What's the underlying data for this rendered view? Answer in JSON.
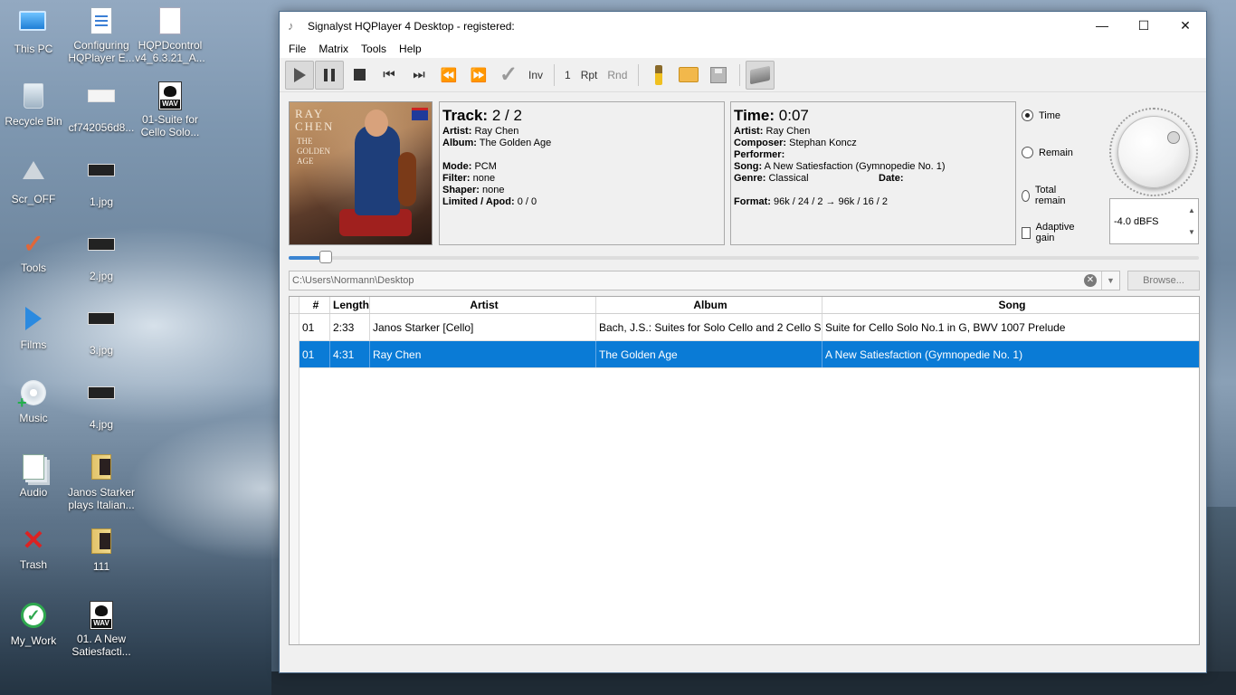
{
  "desktop": {
    "icons": [
      {
        "label": "This PC"
      },
      {
        "label": "Configuring HQPlayer E..."
      },
      {
        "label": "HQPDcontrol v4_6.3.21_A..."
      },
      {
        "label": "Recycle Bin"
      },
      {
        "label": "cf742056d8..."
      },
      {
        "label": "01-Suite for Cello Solo..."
      },
      {
        "label": "Scr_OFF"
      },
      {
        "label": "1.jpg"
      },
      {
        "label": "Tools"
      },
      {
        "label": "2.jpg"
      },
      {
        "label": "Films"
      },
      {
        "label": "3.jpg"
      },
      {
        "label": "Music"
      },
      {
        "label": "4.jpg"
      },
      {
        "label": "Audio"
      },
      {
        "label": "Janos Starker plays Italian..."
      },
      {
        "label": "Trash"
      },
      {
        "label": "111"
      },
      {
        "label": "My_Work"
      },
      {
        "label": "01. A New Satiesfacti..."
      }
    ],
    "wav_badge": "WAV"
  },
  "window": {
    "title": "Signalyst HQPlayer 4 Desktop - registered:",
    "buttons": {
      "minimize": "—",
      "maximize": "☐",
      "close": "✕"
    }
  },
  "menu": [
    {
      "label": "File"
    },
    {
      "label": "Matrix"
    },
    {
      "label": "Tools"
    },
    {
      "label": "Help"
    }
  ],
  "toolbar": {
    "inv": "Inv",
    "one": "1",
    "rpt": "Rpt",
    "rnd": "Rnd",
    "play_pressed": false,
    "pause_pressed": true
  },
  "album_art": {
    "line1": "RAY CHEN",
    "line2": "THE GOLDEN AGE"
  },
  "track_info": {
    "track_label": "Track:",
    "track_value": "2 / 2",
    "artist_label": "Artist:",
    "artist": "Ray Chen",
    "album_label": "Album:",
    "album": "The Golden Age",
    "mode_label": "Mode:",
    "mode": "PCM",
    "filter_label": "Filter:",
    "filter": "none",
    "shaper_label": "Shaper:",
    "shaper": "none",
    "limited_label": "Limited / Apod:",
    "limited": "0 / 0"
  },
  "time_info": {
    "time_label": "Time:",
    "time_value": "0:07",
    "artist_label": "Artist:",
    "artist": "Ray Chen",
    "composer_label": "Composer:",
    "composer": "Stephan Koncz",
    "performer_label": "Performer:",
    "performer": "",
    "song_label": "Song:",
    "song": "A New Satiesfaction (Gymnopedie No. 1)",
    "genre_label": "Genre:",
    "genre": "Classical",
    "date_label": "Date:",
    "date": "",
    "format_label": "Format:",
    "format": "96k / 24 / 2 → 96k / 16 / 2"
  },
  "display_mode": {
    "options": [
      {
        "label": "Time",
        "selected": true
      },
      {
        "label": "Remain",
        "selected": false
      },
      {
        "label": "Total remain",
        "selected": false
      }
    ],
    "adaptive_gain_label": "Adaptive gain",
    "adaptive_gain_checked": false,
    "volume": "-4.0 dBFS"
  },
  "seek": {
    "position_fraction": 0.035
  },
  "path": {
    "value": "C:\\Users\\Normann\\Desktop",
    "browse_label": "Browse..."
  },
  "playlist": {
    "columns": [
      "#",
      "Length",
      "Artist",
      "Album",
      "Song"
    ],
    "rows": [
      {
        "index": "1",
        "num": "01",
        "length": "2:33",
        "artist": "Janos Starker [Cello]",
        "album": "Bach, J.S.: Suites for Solo Cello and 2 Cello S...",
        "song": "Suite for Cello Solo No.1 in G, BWV 1007 Prelude",
        "selected": false
      },
      {
        "index": "2",
        "num": "01",
        "length": "4:31",
        "artist": "Ray Chen",
        "album": "The Golden Age",
        "song": "A New Satiesfaction (Gymnopedie No. 1)",
        "selected": true
      }
    ]
  }
}
